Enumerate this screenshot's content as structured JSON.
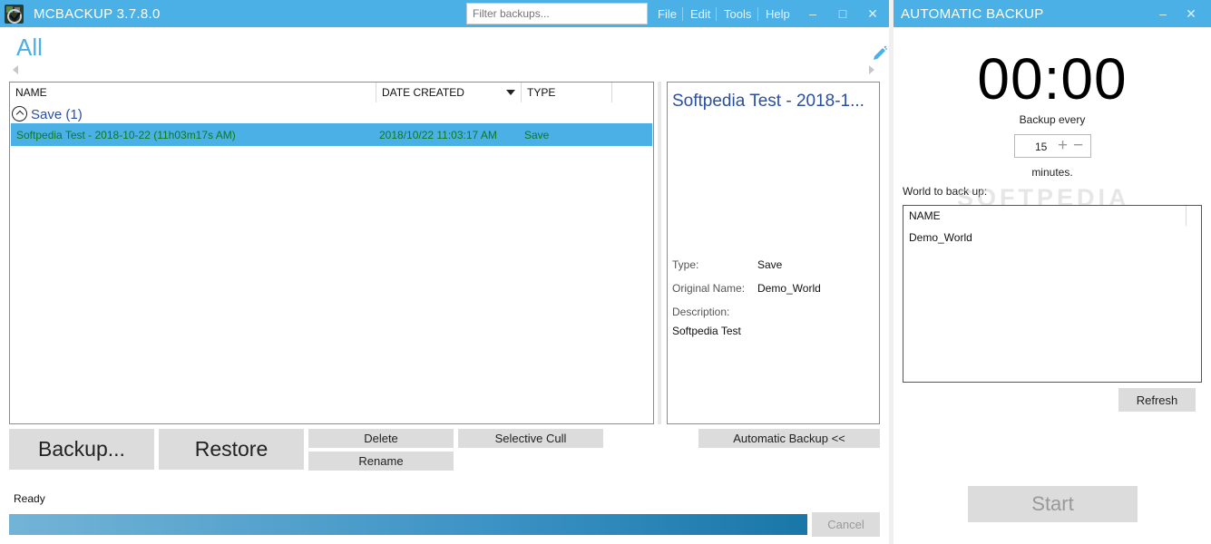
{
  "app": {
    "title": "MCBACKUP 3.7.8.0",
    "accent_color": "#4ab0e5",
    "logo_icon": "mcbackup-logo-icon"
  },
  "search": {
    "placeholder": "Filter backups..."
  },
  "menu": [
    "File",
    "Edit",
    "Tools",
    "Help"
  ],
  "window_buttons": {
    "minimize": "‒",
    "maximize": "□",
    "close": "✕"
  },
  "main": {
    "heading": "All",
    "columns": [
      "NAME",
      "DATE CREATED",
      "TYPE"
    ],
    "group": {
      "label": "Save (1)"
    },
    "rows": [
      {
        "name": "Softpedia Test - 2018-10-22 (11h03m17s AM)",
        "date": "2018/10/22 11:03:17 AM",
        "type": "Save"
      }
    ]
  },
  "detail": {
    "title": "Softpedia Test - 2018-1...",
    "type_label": "Type:",
    "type_value": "Save",
    "original_name_label": "Original Name:",
    "original_name_value": "Demo_World",
    "description_label": "Description:",
    "description_value": "Softpedia Test"
  },
  "buttons": {
    "backup": "Backup...",
    "restore": "Restore",
    "delete": "Delete",
    "rename": "Rename",
    "selective_cull": "Selective Cull",
    "automatic_backup": "Automatic Backup <<",
    "cancel": "Cancel"
  },
  "status": {
    "text": "Ready",
    "progress_fraction": 1.0
  },
  "auto_backup": {
    "title": "AUTOMATIC BACKUP",
    "timer": "00:00",
    "backup_every_label": "Backup every",
    "interval_value": "15",
    "minutes_label": "minutes.",
    "world_label": "World to back up:",
    "world_column": "NAME",
    "worlds": [
      "Demo_World"
    ],
    "refresh": "Refresh",
    "start": "Start",
    "watermark": "SOFTPEDIA"
  }
}
